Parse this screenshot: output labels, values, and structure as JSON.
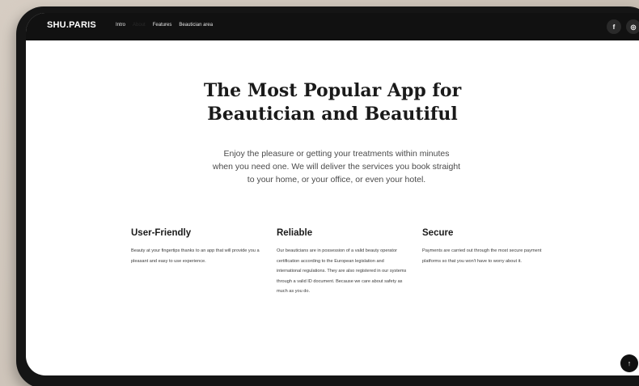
{
  "header": {
    "brand": "SHU.PARIS",
    "nav": [
      {
        "label": "Intro"
      },
      {
        "label": "About"
      },
      {
        "label": "Features"
      },
      {
        "label": "Beautician area"
      }
    ],
    "social": [
      {
        "icon": "facebook-icon",
        "glyph": "f"
      },
      {
        "icon": "instagram-icon",
        "glyph": "◎"
      }
    ]
  },
  "hero": {
    "title_line1": "The Most Popular App for",
    "title_line2": "Beautician and Beautiful",
    "subtitle_line1": "Enjoy the pleasure or getting your treatments within minutes",
    "subtitle_line2": "when you need one. We will deliver the services you book straight",
    "subtitle_line3": "to your home, or your office, or even your hotel."
  },
  "features": [
    {
      "title": "User-Friendly",
      "text": "Beauty at your fingertips thanks to an app that will provide you a pleasant and easy to use experience."
    },
    {
      "title": "Reliable",
      "text": "Our beauticians are in possession of a valid beauty operator certification according to the European legislation and international regulations. They are also registered in our systems through a valid ID document. Because we care about safety as much as you do."
    },
    {
      "title": "Secure",
      "text": "Payments are carried out through the most secure payment platforms so that you won't have to worry about it."
    }
  ],
  "scroll_top": {
    "glyph": "↑"
  },
  "colors": {
    "topbar": "#111111",
    "page": "#ffffff",
    "text": "#1a1a1a",
    "backdrop": "#cfc6bc"
  }
}
